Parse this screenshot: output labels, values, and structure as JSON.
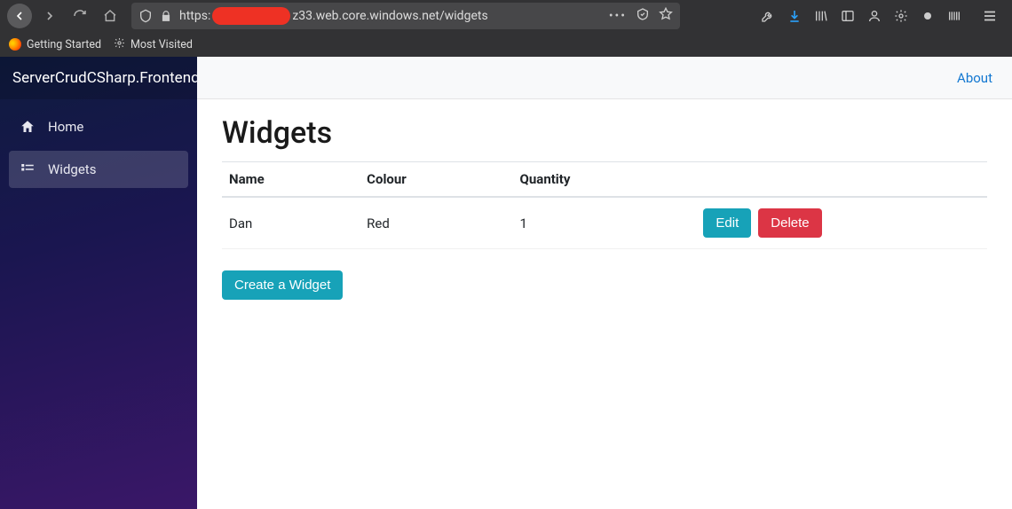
{
  "browser": {
    "url_prefix": "https:",
    "url_suffix": "z33.web.core.windows.net/widgets",
    "bookmarks": [
      {
        "label": "Getting Started"
      },
      {
        "label": "Most Visited"
      }
    ]
  },
  "app": {
    "brand": "ServerCrudCSharp.Frontend",
    "topnav": {
      "about": "About"
    },
    "sidebar": {
      "items": [
        {
          "label": "Home"
        },
        {
          "label": "Widgets"
        }
      ]
    },
    "page": {
      "title": "Widgets",
      "columns": {
        "name": "Name",
        "colour": "Colour",
        "quantity": "Quantity"
      },
      "rows": [
        {
          "name": "Dan",
          "colour": "Red",
          "quantity": "1"
        }
      ],
      "actions": {
        "edit": "Edit",
        "delete": "Delete",
        "create": "Create a Widget"
      }
    }
  }
}
